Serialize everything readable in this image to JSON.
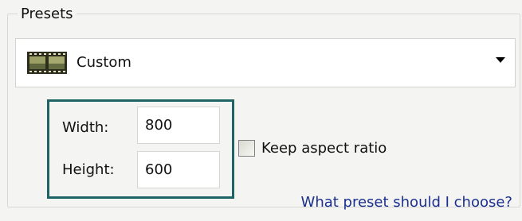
{
  "presets": {
    "title": "Presets",
    "selected": "Custom",
    "selected_icon": "film-strip-icon"
  },
  "dimensions": {
    "width_label": "Width:",
    "width_value": "800",
    "height_label": "Height:",
    "height_value": "600",
    "frame_color": "#1f6465"
  },
  "options": {
    "keep_aspect_label": "Keep aspect ratio",
    "keep_aspect_checked": false
  },
  "help": {
    "link_text": "What preset should I choose?",
    "link_color": "#1a2f8f"
  }
}
